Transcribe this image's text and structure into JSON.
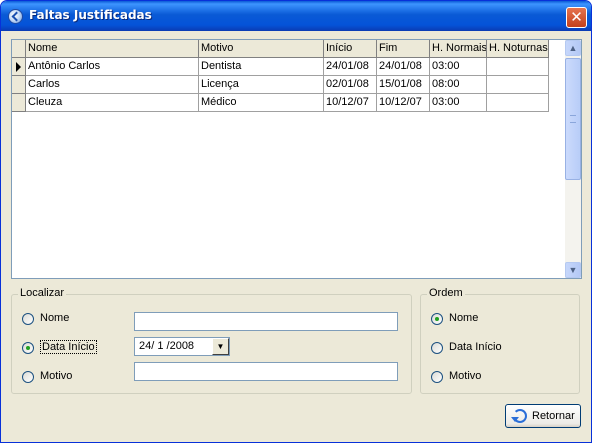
{
  "window": {
    "title": "Faltas Justificadas",
    "close_glyph": "✕"
  },
  "grid": {
    "columns": [
      "Nome",
      "Motivo",
      "Início",
      "Fim",
      "H. Normais",
      "H. Noturnas"
    ],
    "rows": [
      [
        "Antônio Carlos",
        "Dentista",
        "24/01/08",
        "24/01/08",
        "03:00",
        ""
      ],
      [
        "Carlos",
        "Licença",
        "02/01/08",
        "15/01/08",
        "08:00",
        ""
      ],
      [
        "Cleuza",
        "Médico",
        "10/12/07",
        "10/12/07",
        "03:00",
        ""
      ]
    ],
    "current_row": 0,
    "scroll_up_glyph": "▲",
    "scroll_down_glyph": "▼"
  },
  "localizar": {
    "legend": "Localizar",
    "options": [
      "Nome",
      "Data Início",
      "Motivo"
    ],
    "selected": 1,
    "nome_value": "",
    "data_value": "24/ 1 /2008",
    "motivo_value": "",
    "dropdown_glyph": "▼"
  },
  "ordem": {
    "legend": "Ordem",
    "options": [
      "Nome",
      "Data Início",
      "Motivo"
    ],
    "selected": 0
  },
  "buttons": {
    "retornar": "Retornar"
  },
  "icons": {
    "title": "app-circle-icon",
    "close": "close-icon",
    "row_indicator": "current-row-arrow-icon",
    "retornar": "return-arrow-icon"
  },
  "colors": {
    "title_bar": "#0a5ad6",
    "close_button": "#d2502a",
    "window_bg": "#ece9d8",
    "radio_dot": "#21a121"
  }
}
